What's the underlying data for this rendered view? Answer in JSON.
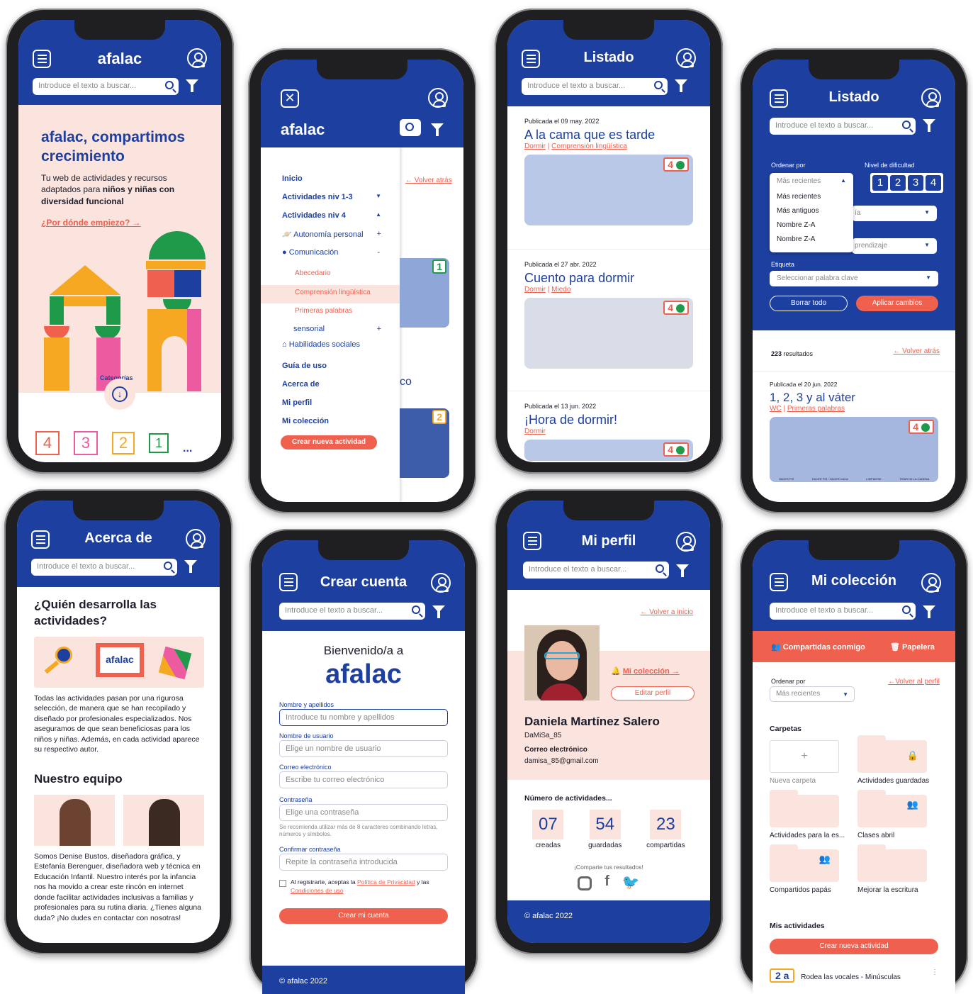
{
  "search_placeholder": "Introduce el texto a buscar...",
  "p1": {
    "brand": "afalac",
    "hero_title": "afalac, compartimos crecimiento",
    "hero_text_1": "Tu web de actividades y recursos adaptados para ",
    "hero_text_bold": "niños y niñas con diversidad funcional",
    "start_link": "¿Por dónde empiezo? →",
    "categories_label": "Categorías",
    "levels": [
      "4",
      "3",
      "2",
      "1"
    ],
    "more": "..."
  },
  "p2": {
    "brand": "afalac",
    "back": "← Volver atrás",
    "menu": [
      "Inicio",
      "Actividades niv 1-3",
      "Actividades niv 4",
      "Autonomía personal",
      "Comunicación",
      "Abecedario",
      "Comprensión lingüística",
      "Primeras palabras",
      "sensorial",
      "Habilidades sociales",
      "Guía de uso",
      "Acerca de",
      "Mi perfil",
      "Mi colección"
    ],
    "create_btn": "Crear nueva actividad",
    "badges": [
      "1",
      "2"
    ],
    "partial": "co"
  },
  "p3": {
    "title": "Listado",
    "items": [
      {
        "date": "Publicada el 09 may. 2022",
        "title": "A la cama que es tarde",
        "tags": [
          "Dormir",
          "Comprensión lingüística"
        ],
        "level": "4"
      },
      {
        "date": "Publicada el 27 abr. 2022",
        "title": "Cuento para dormir",
        "tags": [
          "Dormir",
          "Miedo"
        ],
        "level": "4"
      },
      {
        "date": "Publicada el 13 jun. 2022",
        "title": "¡Hora de dormir!",
        "tags": [
          "Dormir"
        ],
        "level": "4"
      }
    ]
  },
  "p4": {
    "title": "Listado",
    "order_label": "Ordenar por",
    "order_value": "Más recientes",
    "order_options": [
      "Más recientes",
      "Más antiguos",
      "Nombre Z-A",
      "Nombre Z-A"
    ],
    "difficulty_label": "Nivel de dificultad",
    "levels": [
      "1",
      "2",
      "3",
      "4"
    ],
    "partial_1": "ía",
    "partial_2": "prendizaje",
    "tag_label": "Etiqueta",
    "tag_placeholder": "Seleccionar palabra clave",
    "clear_btn": "Borrar todo",
    "apply_btn": "Aplicar cambios",
    "results_count": "223",
    "results_label": " resultados",
    "back": "← Volver atrás",
    "item": {
      "date": "Publicada el 20 jun. 2022",
      "title": "1, 2, 3 y al váter",
      "tags": [
        "WC",
        "Primeras palabras"
      ],
      "level": "4"
    },
    "steps": [
      "HACER PIS",
      "HACER PIS / HACER CACA",
      "LIMPIARSE",
      "TIRAR DE LA CADENA"
    ]
  },
  "p5": {
    "title": "Acerca de",
    "q_title": "¿Quién desarrolla las actividades?",
    "logo": "afalac",
    "text": "Todas las actividades pasan por una rigurosa selección, de manera que se han recopilado y diseñado por profesionales especializados. Nos aseguramos de que sean beneficiosas para los niños y niñas. Además, en cada actividad aparece su respectivo autor.",
    "team_title": "Nuestro equipo",
    "team_text": "Somos Denise Bustos, diseñadora gráfica, y Estefanía Berenguer, diseñadora web y técnica en Educación Infantil. Nuestro interés por la infancia nos ha movido a crear este rincón en internet donde facilitar actividades inclusivas a familias y profesionales para su rutina diaria. ¿Tienes alguna duda? ¡No dudes en contactar con nosotras!"
  },
  "p6": {
    "title": "Crear cuenta",
    "welcome": "Bienvenido/a a",
    "brand": "afalac",
    "fields": [
      {
        "label": "Nombre y apellidos",
        "placeholder": "Introduce tu nombre y apellidos"
      },
      {
        "label": "Nombre de usuario",
        "placeholder": "Elige un nombre de usuario"
      },
      {
        "label": "Correo electrónico",
        "placeholder": "Escribe tu correo electrónico"
      },
      {
        "label": "Contraseña",
        "placeholder": "Elige una contraseña"
      },
      {
        "label": "Confirmar contraseña",
        "placeholder": "Repite la contraseña introducida"
      }
    ],
    "pw_hint": "Se recomienda utilizar más de 8 caracteres combinando letras, números y símbolos.",
    "terms_1": "Al registrarte, aceptas la ",
    "terms_link1": "Política de Privacidad",
    "terms_2": " y las ",
    "terms_link2": "Condiciones de uso",
    "submit": "Crear mi cuenta",
    "footer": "© afalac 2022"
  },
  "p7": {
    "title": "Mi perfil",
    "back": "← Volver a inicio",
    "collection_link": "Mi colección →",
    "edit_btn": "Editar perfil",
    "name": "Daniela Martínez Salero",
    "username": "DaMiSa_85",
    "email_label": "Correo electrónico",
    "email": "damisa_85@gmail.com",
    "activities_label": "Número de actividades...",
    "stats": [
      {
        "value": "07",
        "label": "creadas"
      },
      {
        "value": "54",
        "label": "guardadas"
      },
      {
        "value": "23",
        "label": "compartidas"
      }
    ],
    "share": "¡Comparte tus resultados!",
    "footer": "© afalac 2022"
  },
  "p8": {
    "title": "Mi colección",
    "shared_tab": "Compartidas conmigo",
    "trash_tab": "Papelera",
    "order_label": "Ordenar por",
    "order_value": "Más recientes",
    "back": "←Volver al perfil",
    "folders_title": "Carpetas",
    "folders": [
      "Nueva carpeta",
      "Actividades guardadas",
      "Actividades para la es...",
      "Clases abril",
      "Compartidos papás",
      "Mejorar la escritura"
    ],
    "my_activities": "Mis actividades",
    "create_btn": "Crear nueva actividad",
    "activity": "Rodea las vocales - Minúsculas",
    "activity_badge": "2 a"
  }
}
